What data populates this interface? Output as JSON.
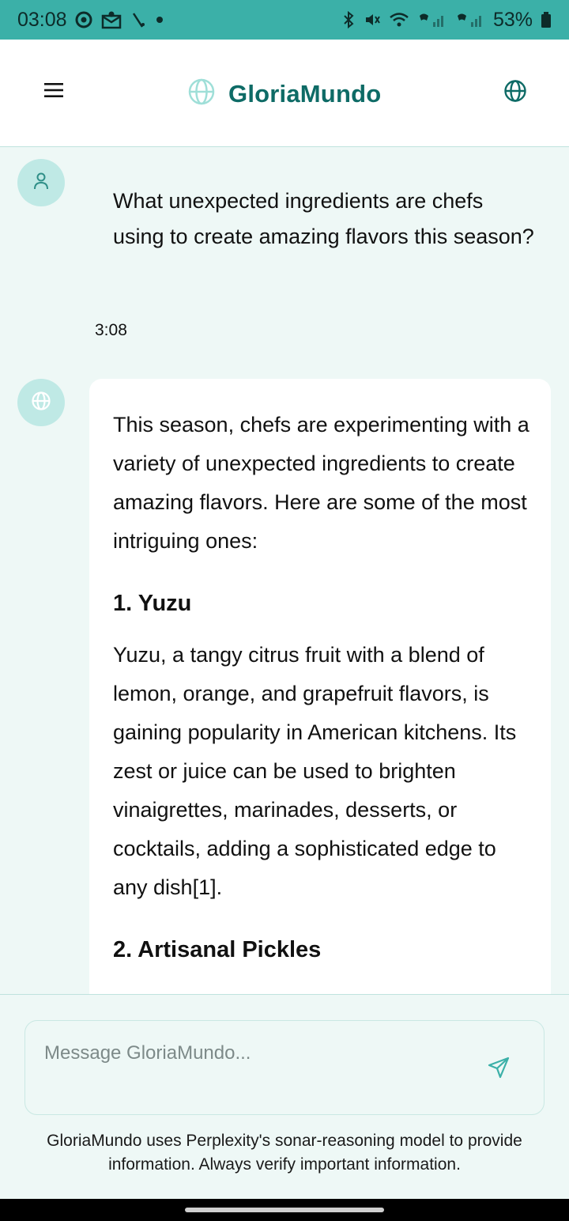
{
  "status_bar": {
    "time": "03:08",
    "battery": "53%",
    "left_icons": [
      "chrome-icon",
      "mail-notification-icon",
      "signal-slash-icon",
      "dot-icon"
    ],
    "right_icons": [
      "bluetooth-icon",
      "mute-icon",
      "wifi-icon",
      "sim1-signal-icon",
      "sim2-signal-icon",
      "battery-icon"
    ]
  },
  "header": {
    "title": "GloriaMundo",
    "menu_icon": "hamburger-menu-icon",
    "logo_icon": "globe-icon",
    "language_icon": "globe-icon"
  },
  "conversation": {
    "user_message": "What unexpected ingredients are chefs using to create amazing flavors this season?",
    "user_time": "3:08",
    "assistant": {
      "intro": "This season, chefs are experimenting with a variety of unexpected ingredients to create amazing flavors. Here are some of the most intriguing ones:",
      "sections": [
        {
          "heading": "1. Yuzu",
          "text": "Yuzu, a tangy citrus fruit with a blend of lemon, orange, and grapefruit flavors, is gaining popularity in American kitchens. Its zest or juice can be used to brighten vinaigrettes, marinades, desserts, or cocktails, adding a sophisticated edge to any dish[1]."
        },
        {
          "heading": "2. Artisanal Pickles",
          "text": ""
        }
      ]
    }
  },
  "composer": {
    "placeholder": "Message GloriaMundo...",
    "value": "",
    "send_icon": "send-icon",
    "disclaimer": "GloriaMundo uses Perplexity's sonar-reasoning model to provide information. Always verify important information."
  },
  "colors": {
    "status_bar": "#3bb0a8",
    "brand": "#0e6b66",
    "accent_light": "#bfe9e5",
    "background": "#eef8f6"
  }
}
